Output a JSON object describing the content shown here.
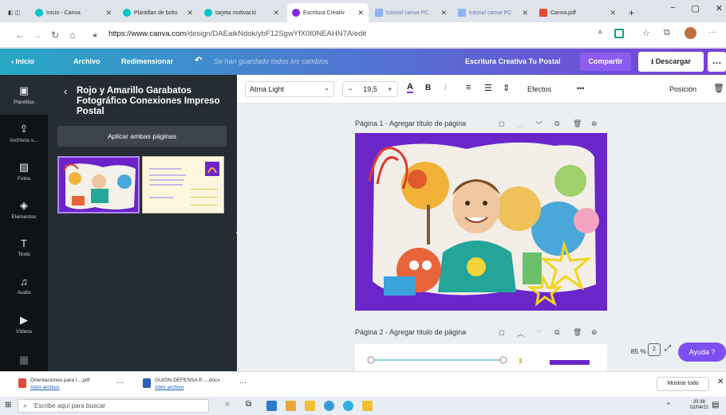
{
  "browser": {
    "tabs": [
      {
        "label": "Inicio - Canva",
        "color": "#00c4cc"
      },
      {
        "label": "Plantillas de bolsi",
        "color": "#00c4cc"
      },
      {
        "label": "tarjeta motivació",
        "color": "#00c4cc"
      },
      {
        "label": "Escritura Creativ",
        "color": "#7d2ae8",
        "active": true
      },
      {
        "label": "tutorial canva PC",
        "color": "#8ab4f8"
      },
      {
        "label": "tutorial canva PC",
        "color": "#8ab4f8"
      },
      {
        "label": "Canva.pdf",
        "color": "#e04a3a"
      }
    ],
    "url_prefix": "https://www.canva.com",
    "url_path": "/design/DAEaikNdok/ybF12SgwYfX0I0NEAHN7A/edit"
  },
  "header": {
    "back_label": "Inicio",
    "file_label": "Archivo",
    "resize_label": "Redimensionar",
    "save_status": "Se han guardado todos los cambios",
    "design_title": "Escritura Creativa Tu Postal",
    "share_label": "Compartir",
    "download_label": "Descargar",
    "more_label": "…"
  },
  "rail": [
    {
      "label": "Plantillas",
      "icon": "▣"
    },
    {
      "label": "Archivos s...",
      "icon": "⇪"
    },
    {
      "label": "Fotos",
      "icon": "▨"
    },
    {
      "label": "Elementos",
      "icon": "◈"
    },
    {
      "label": "Texto",
      "icon": "T"
    },
    {
      "label": "Audio",
      "icon": "♫"
    },
    {
      "label": "Vídeos",
      "icon": "▶"
    }
  ],
  "panel": {
    "title": "Rojo y Amarillo Garabatos Fotográfico Conexiones Impreso Postal",
    "apply_label": "Aplicar ambas páginas"
  },
  "toolbar": {
    "font": "Atma Light",
    "size_minus": "−",
    "size": "19,5",
    "size_plus": "+",
    "color_label": "A",
    "bold_label": "B",
    "italic_label": "I",
    "effects_label": "Efectos",
    "more_label": "•••",
    "position_label": "Posición"
  },
  "canvas": {
    "page1_label": "Página 1 - Agregar título de página",
    "page2_label": "Página 2 - Agregar título de página",
    "zoom": "85 %",
    "page_count": "2",
    "help_label": "Ayuda ?"
  },
  "downloads": {
    "items": [
      {
        "name": "Orientaciones para l....pdf",
        "action": "Abrir archivo"
      },
      {
        "name": "GUIÓN DEFENSA P.....docx",
        "action": "Abrir archivo"
      }
    ],
    "show_all_label": "Mostrar todo"
  },
  "taskbar": {
    "search_placeholder": "Escribe aquí para buscar",
    "time": "20:38",
    "date": "02/04/21"
  },
  "colors": {
    "accent": "#7d2ae8",
    "card_bg": "#6a26c9"
  }
}
